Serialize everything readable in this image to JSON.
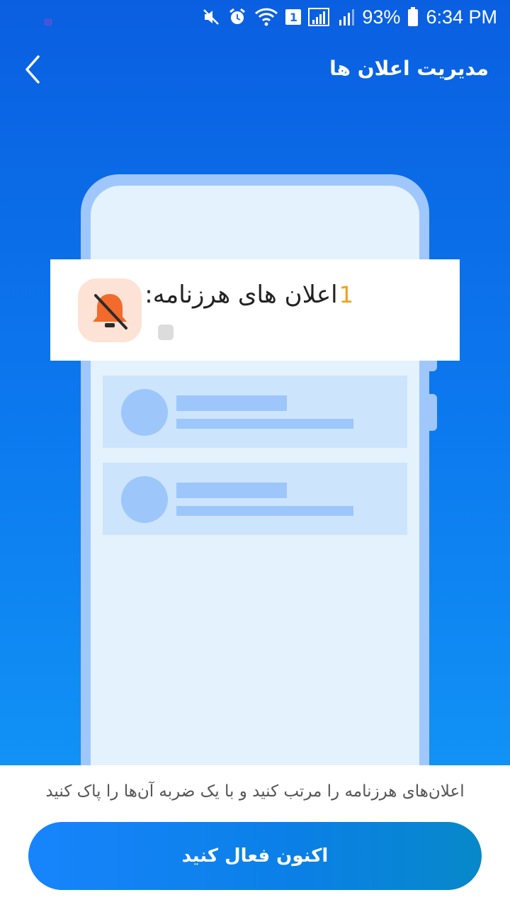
{
  "status_bar": {
    "battery_percent": "93%",
    "time": "6:34 PM",
    "sim_badge": "1",
    "icons": [
      "mute-icon",
      "alarm-icon",
      "wifi-icon",
      "sim-badge",
      "signal-icon",
      "signal-icon",
      "battery-icon"
    ]
  },
  "header": {
    "title": "مدیریت اعلان ها",
    "back_icon": "chevron-left-icon"
  },
  "notification": {
    "count": "1",
    "title": "اعلان های هرزنامه:",
    "icon": "bell-off-icon"
  },
  "bottom": {
    "description": "اعلان‌های هرزنامه را مرتب کنید و با یک ضربه آن‌ها را پاک کنید",
    "cta_label": "اکنون فعال کنید"
  },
  "colors": {
    "background_top": "#0a5fe0",
    "background_bottom": "#1192f5",
    "accent_orange": "#f0a21a",
    "icon_orange": "#f26a2c",
    "cta_blue": "#1784fc"
  }
}
